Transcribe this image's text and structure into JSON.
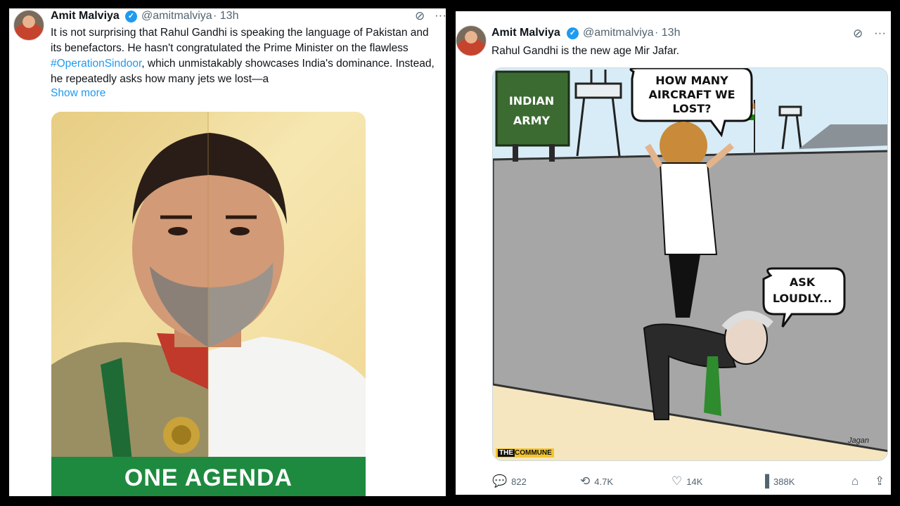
{
  "left_tweet": {
    "author_name": "Amit Malviya",
    "handle": "@amitmalviya",
    "time": "· 13h",
    "text_before": "It is not surprising that Rahul Gandhi is speaking the language of Pakistan and its benefactors. He hasn't congratulated the Prime Minister on the flawless ",
    "hashtag": "#OperationSindoor",
    "text_after": ", which unmistakably showcases India's dominance. Instead, he repeatedly asks how many jets we lost—a",
    "show_more": "Show more",
    "image_banner": "ONE AGENDA",
    "icons": {
      "grok": "grok-icon",
      "more": "more-icon"
    }
  },
  "right_tweet": {
    "author_name": "Amit Malviya",
    "handle": "@amitmalviya",
    "time": "· 13h",
    "text": "Rahul Gandhi is the new age Mir Jafar.",
    "cartoon": {
      "sign_line1": "INDIAN",
      "sign_line2": "ARMY",
      "bubble1_line1": "HOW MANY",
      "bubble1_line2": "AIRCRAFT WE",
      "bubble1_line3": "LOST?",
      "bubble2_line1": "ASK",
      "bubble2_line2": "LOUDLY...",
      "brand_the": "THE",
      "brand_name": "COMMUNE",
      "signature": "Jagan"
    },
    "actions": {
      "replies": "822",
      "reposts": "4.7K",
      "likes": "14K",
      "views": "388K"
    }
  },
  "colors": {
    "accent": "#1d9bf0",
    "banner_green": "#1e8a3f",
    "text_secondary": "#536471"
  }
}
